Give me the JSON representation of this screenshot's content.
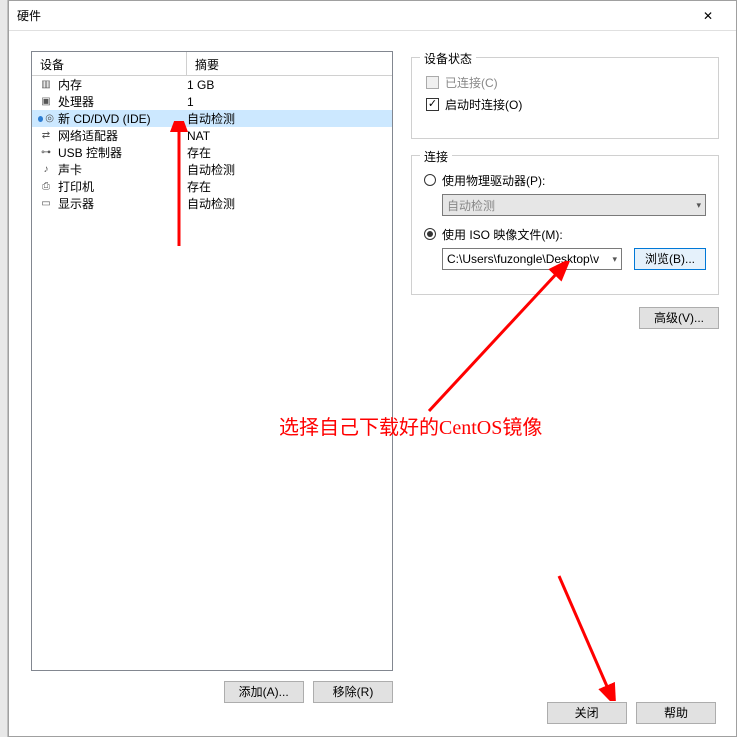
{
  "window": {
    "title": "硬件"
  },
  "list": {
    "header_device": "设备",
    "header_summary": "摘要",
    "rows": [
      {
        "icon": "memory-icon",
        "name": "内存",
        "summary": "1 GB"
      },
      {
        "icon": "cpu-icon",
        "name": "处理器",
        "summary": "1"
      },
      {
        "icon": "cd-icon",
        "name": "新 CD/DVD (IDE)",
        "summary": "自动检测",
        "selected": true
      },
      {
        "icon": "network-icon",
        "name": "网络适配器",
        "summary": "NAT"
      },
      {
        "icon": "usb-icon",
        "name": "USB 控制器",
        "summary": "存在"
      },
      {
        "icon": "sound-icon",
        "name": "声卡",
        "summary": "自动检测"
      },
      {
        "icon": "printer-icon",
        "name": "打印机",
        "summary": "存在"
      },
      {
        "icon": "display-icon",
        "name": "显示器",
        "summary": "自动检测"
      }
    ]
  },
  "buttons": {
    "add": "添加(A)...",
    "remove": "移除(R)",
    "browse": "浏览(B)...",
    "advanced": "高级(V)...",
    "close": "关闭",
    "help": "帮助"
  },
  "status": {
    "legend": "设备状态",
    "connected": "已连接(C)",
    "connect_on_power": "启动时连接(O)"
  },
  "connection": {
    "legend": "连接",
    "use_physical": "使用物理驱动器(P):",
    "auto_detect": "自动检测",
    "use_iso": "使用 ISO 映像文件(M):",
    "iso_path": "C:\\Users\\fuzongle\\Desktop\\v"
  },
  "annotation": "选择自己下载好的CentOS镜像"
}
